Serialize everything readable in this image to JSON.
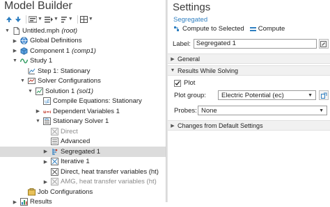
{
  "left": {
    "title": "Model Builder",
    "tree": [
      {
        "indent": 0,
        "arrow": "down",
        "icon": "file-icon",
        "label": "Untitled.mph",
        "tag": "(root)"
      },
      {
        "indent": 1,
        "arrow": "right",
        "icon": "globe-icon",
        "label": "Global Definitions",
        "tag": ""
      },
      {
        "indent": 1,
        "arrow": "right",
        "icon": "component-icon",
        "label": "Component 1",
        "tag": "(comp1)"
      },
      {
        "indent": 1,
        "arrow": "down",
        "icon": "study-icon",
        "label": "Study 1",
        "tag": ""
      },
      {
        "indent": 2,
        "arrow": "",
        "icon": "step-icon",
        "label": "Step 1: Stationary",
        "tag": ""
      },
      {
        "indent": 2,
        "arrow": "down",
        "icon": "solver-config-icon",
        "label": "Solver Configurations",
        "tag": ""
      },
      {
        "indent": 3,
        "arrow": "down",
        "icon": "solution-icon",
        "label": "Solution 1",
        "tag": "(sol1)"
      },
      {
        "indent": 4,
        "arrow": "",
        "icon": "compile-icon",
        "label": "Compile Equations: Stationary",
        "tag": ""
      },
      {
        "indent": 4,
        "arrow": "right",
        "icon": "variables-icon",
        "label": "Dependent Variables 1",
        "tag": ""
      },
      {
        "indent": 4,
        "arrow": "down",
        "icon": "stationary-solver-icon",
        "label": "Stationary Solver 1",
        "tag": ""
      },
      {
        "indent": 5,
        "arrow": "",
        "icon": "direct-icon",
        "label": "Direct",
        "tag": "",
        "disabled": true
      },
      {
        "indent": 5,
        "arrow": "",
        "icon": "advanced-icon",
        "label": "Advanced",
        "tag": ""
      },
      {
        "indent": 5,
        "arrow": "right",
        "icon": "segregated-icon",
        "label": "Segregated 1",
        "tag": "",
        "selected": true
      },
      {
        "indent": 5,
        "arrow": "right",
        "icon": "iterative-icon",
        "label": "Iterative 1",
        "tag": ""
      },
      {
        "indent": 5,
        "arrow": "",
        "icon": "direct-ht-icon",
        "label": "Direct, heat transfer variables (ht)",
        "tag": ""
      },
      {
        "indent": 5,
        "arrow": "right",
        "icon": "amg-icon",
        "label": "AMG, heat transfer variables (ht)",
        "tag": "",
        "disabled": true
      },
      {
        "indent": 2,
        "arrow": "",
        "icon": "job-config-icon",
        "label": "Job Configurations",
        "tag": ""
      },
      {
        "indent": 1,
        "arrow": "right",
        "icon": "results-icon",
        "label": "Results",
        "tag": ""
      }
    ]
  },
  "right": {
    "title": "Settings",
    "subtitle": "Segregated",
    "compute_to_selected": "Compute to Selected",
    "compute": "Compute",
    "label_caption": "Label:",
    "label_value": "Segregated 1",
    "sections": {
      "general": "General",
      "results_while_solving": "Results While Solving",
      "changes_from_default": "Changes from Default Settings"
    },
    "plot_checkbox": "Plot",
    "plot_group_caption": "Plot group:",
    "plot_group_value": "Electric Potential (ec)",
    "probes_caption": "Probes:",
    "probes_value": "None"
  },
  "colors": {
    "accent": "#2f7fc1",
    "selected_row": "#dcdcdc",
    "section_bg": "#f1f1f1"
  }
}
